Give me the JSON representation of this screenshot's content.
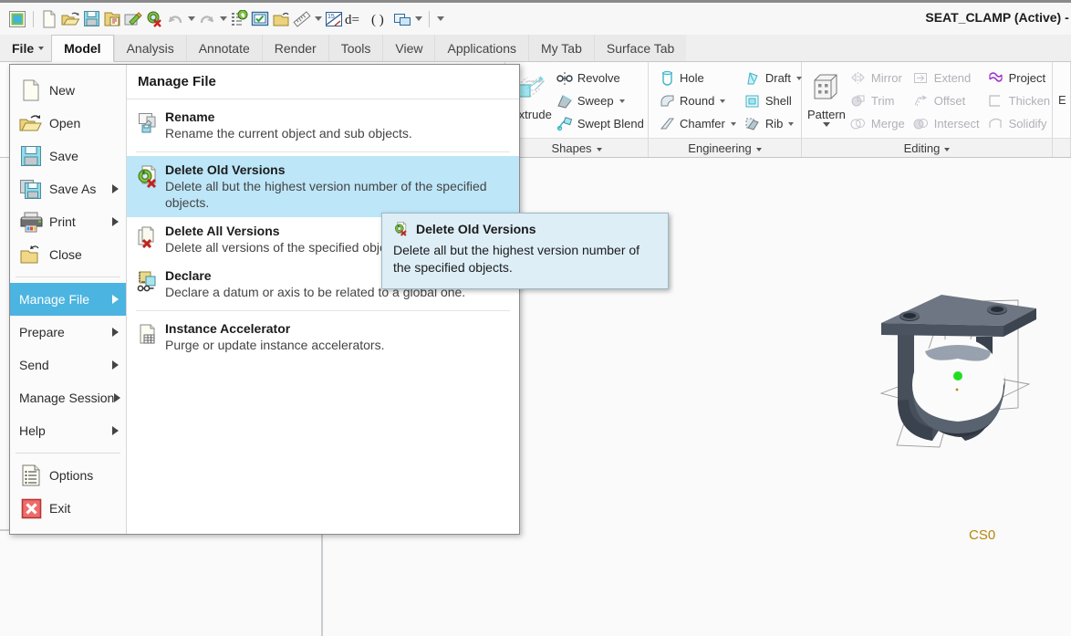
{
  "window": {
    "title": "SEAT_CLAMP (Active) - Creo Par"
  },
  "quick_access": {
    "icons": [
      "creo-logo-icon",
      "new-file-icon",
      "open-folder-icon",
      "save-icon",
      "save-a-copy-icon",
      "edit-rename-icon",
      "erase-not-displayed-icon",
      "undo-icon",
      "undo-dropdown-caret",
      "redo-icon",
      "redo-dropdown-caret",
      "regenerate-icon",
      "select-items-icon",
      "close-window-icon",
      "measure-icon",
      "measure-dropdown-caret",
      "switch-dimensions-icon",
      "parameters-icon",
      "relations-icon",
      "window-manager-icon",
      "window-dropdown-caret",
      "customize-qat-caret"
    ]
  },
  "tabs": [
    {
      "label": "File",
      "active": false,
      "is_file": true
    },
    {
      "label": "Model",
      "active": true
    },
    {
      "label": "Analysis",
      "active": false
    },
    {
      "label": "Annotate",
      "active": false
    },
    {
      "label": "Render",
      "active": false
    },
    {
      "label": "Tools",
      "active": false
    },
    {
      "label": "View",
      "active": false
    },
    {
      "label": "Applications",
      "active": false
    },
    {
      "label": "My Tab",
      "active": false
    },
    {
      "label": "Surface Tab",
      "active": false
    }
  ],
  "ribbon": {
    "groups": [
      {
        "title": "Shapes",
        "big": {
          "label": "Extrude",
          "icon": "extrude-icon",
          "caret": false
        },
        "small": [
          {
            "label": "Revolve",
            "icon": "revolve-icon",
            "caret": false,
            "disabled": false
          },
          {
            "label": "Sweep",
            "icon": "sweep-icon",
            "caret": true,
            "disabled": false
          },
          {
            "label": "Swept Blend",
            "icon": "swept-blend-icon",
            "caret": false,
            "disabled": false
          }
        ]
      },
      {
        "title": "Engineering",
        "columns": [
          [
            {
              "label": "Hole",
              "icon": "hole-icon",
              "caret": false,
              "disabled": false
            },
            {
              "label": "Round",
              "icon": "round-icon",
              "caret": true,
              "disabled": false
            },
            {
              "label": "Chamfer",
              "icon": "chamfer-icon",
              "caret": true,
              "disabled": false
            }
          ],
          [
            {
              "label": "Draft",
              "icon": "draft-icon",
              "caret": true,
              "disabled": false
            },
            {
              "label": "Shell",
              "icon": "shell-icon",
              "caret": false,
              "disabled": false
            },
            {
              "label": "Rib",
              "icon": "rib-icon",
              "caret": true,
              "disabled": false
            }
          ]
        ]
      },
      {
        "title": "Editing",
        "big": {
          "label": "Pattern",
          "icon": "pattern-icon",
          "caret": true
        },
        "columns": [
          [
            {
              "label": "Mirror",
              "icon": "mirror-icon",
              "caret": false,
              "disabled": true
            },
            {
              "label": "Trim",
              "icon": "trim-icon",
              "caret": false,
              "disabled": true
            },
            {
              "label": "Merge",
              "icon": "merge-icon",
              "caret": false,
              "disabled": true
            }
          ],
          [
            {
              "label": "Extend",
              "icon": "extend-icon",
              "caret": false,
              "disabled": true
            },
            {
              "label": "Offset",
              "icon": "offset-icon",
              "caret": false,
              "disabled": true
            },
            {
              "label": "Intersect",
              "icon": "intersect-icon",
              "caret": false,
              "disabled": true
            }
          ],
          [
            {
              "label": "Project",
              "icon": "project-icon",
              "caret": false,
              "disabled": false
            },
            {
              "label": "Thicken",
              "icon": "thicken-icon",
              "caret": false,
              "disabled": true
            },
            {
              "label": "Solidify",
              "icon": "solidify-icon",
              "caret": false,
              "disabled": true
            }
          ]
        ]
      },
      {
        "title": "",
        "clipped_label": "E"
      }
    ]
  },
  "file_menu": {
    "sidebar": [
      {
        "label": "New",
        "icon": "new-file-icon",
        "arrow": false,
        "selected": false
      },
      {
        "label": "Open",
        "icon": "open-folder-icon",
        "arrow": false,
        "selected": false
      },
      {
        "label": "Save",
        "icon": "save-icon",
        "arrow": false,
        "selected": false
      },
      {
        "label": "Save As",
        "icon": "save-as-icon",
        "arrow": true,
        "selected": false
      },
      {
        "label": "Print",
        "icon": "printer-icon",
        "arrow": true,
        "selected": false
      },
      {
        "label": "Close",
        "icon": "close-folder-icon",
        "arrow": false,
        "selected": false
      },
      {
        "label": "Manage File",
        "icon": "",
        "arrow": true,
        "selected": true
      },
      {
        "label": "Prepare",
        "icon": "",
        "arrow": true,
        "selected": false
      },
      {
        "label": "Send",
        "icon": "",
        "arrow": true,
        "selected": false
      },
      {
        "label": "Manage Session",
        "icon": "",
        "arrow": true,
        "selected": false
      },
      {
        "label": "Help",
        "icon": "",
        "arrow": true,
        "selected": false
      },
      {
        "label": "Options",
        "icon": "options-icon",
        "arrow": false,
        "selected": false
      },
      {
        "label": "Exit",
        "icon": "exit-icon",
        "arrow": false,
        "selected": false
      }
    ],
    "panel_title": "Manage File",
    "items": [
      {
        "name": "Rename",
        "desc": "Rename the current object and sub objects.",
        "icon": "rename-icon",
        "selected": false
      },
      {
        "name": "Delete Old Versions",
        "desc": "Delete all but the highest version number of the specified objects.",
        "icon": "delete-old-versions-icon",
        "selected": true
      },
      {
        "name": "Delete All Versions",
        "desc": "Delete all versions of the specified objects from the disk.",
        "icon": "delete-all-versions-icon",
        "selected": false
      },
      {
        "name": "Declare",
        "desc": "Declare a datum or axis to be related to a global one.",
        "icon": "declare-icon",
        "selected": false
      },
      {
        "name": "Instance Accelerator",
        "desc": "Purge or update instance accelerators.",
        "icon": "instance-accelerator-icon",
        "selected": false
      }
    ]
  },
  "tooltip": {
    "title": "Delete Old Versions",
    "body": "Delete all but the highest version number of the specified objects.",
    "icon": "delete-old-versions-icon"
  },
  "model_view": {
    "csys_label": "CS0",
    "model_name": "seat-clamp-bracket"
  },
  "colors": {
    "accent_blue": "#4cb4e0",
    "highlight_row": "#bde6f8",
    "tooltip_bg": "#ddeef7",
    "canvas_bg": "#fafafa",
    "csys_label": "#b8860b"
  }
}
